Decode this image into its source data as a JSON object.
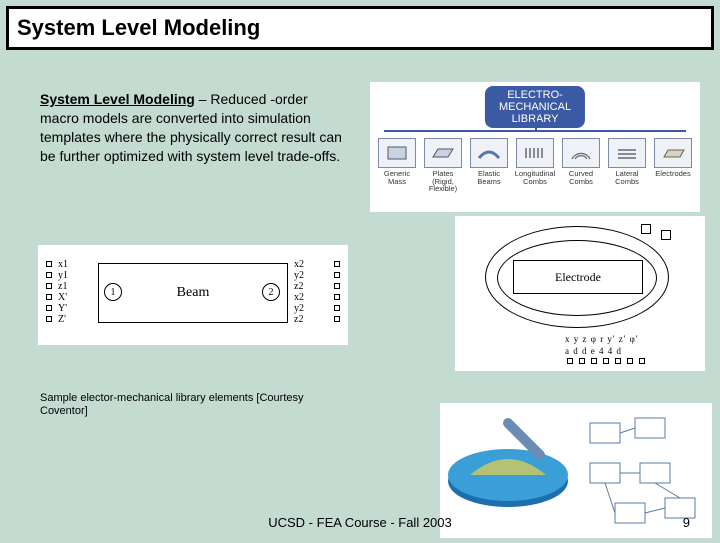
{
  "title": "System Level Modeling",
  "description": {
    "lead": "System Level Modeling",
    "rest": " – Reduced -order macro models are converted into simulation templates where the physically correct result can be further optimized with system level trade-offs."
  },
  "library": {
    "header_line1": "ELECTRO-",
    "header_line2": "MECHANICAL",
    "header_line3": "LIBRARY",
    "items": [
      {
        "label": "Generic\nMass"
      },
      {
        "label": "Plates\n(Rigid,\nFlexible)"
      },
      {
        "label": "Elastic\nBeams"
      },
      {
        "label": "Longitudinal\nCombs"
      },
      {
        "label": "Curved\nCombs"
      },
      {
        "label": "Lateral\nCombs"
      },
      {
        "label": "Electrodes"
      }
    ]
  },
  "beam": {
    "title": "Beam",
    "port1": "1",
    "port2": "2",
    "left_ports": [
      "x1",
      "y1",
      "z1",
      "X'",
      "Y'",
      "Z'"
    ],
    "right_ports": [
      "x2",
      "y2",
      "z2",
      "x2",
      "y2",
      "z2"
    ]
  },
  "electrode": {
    "title": "Electrode",
    "row1": "x y z φ r y' z' φ'",
    "row2": "a d d e 4 4  d"
  },
  "caption": "Sample elector-mechanical library elements [Courtesy Coventor]",
  "footer": "UCSD - FEA Course - Fall 2003",
  "page": "9"
}
